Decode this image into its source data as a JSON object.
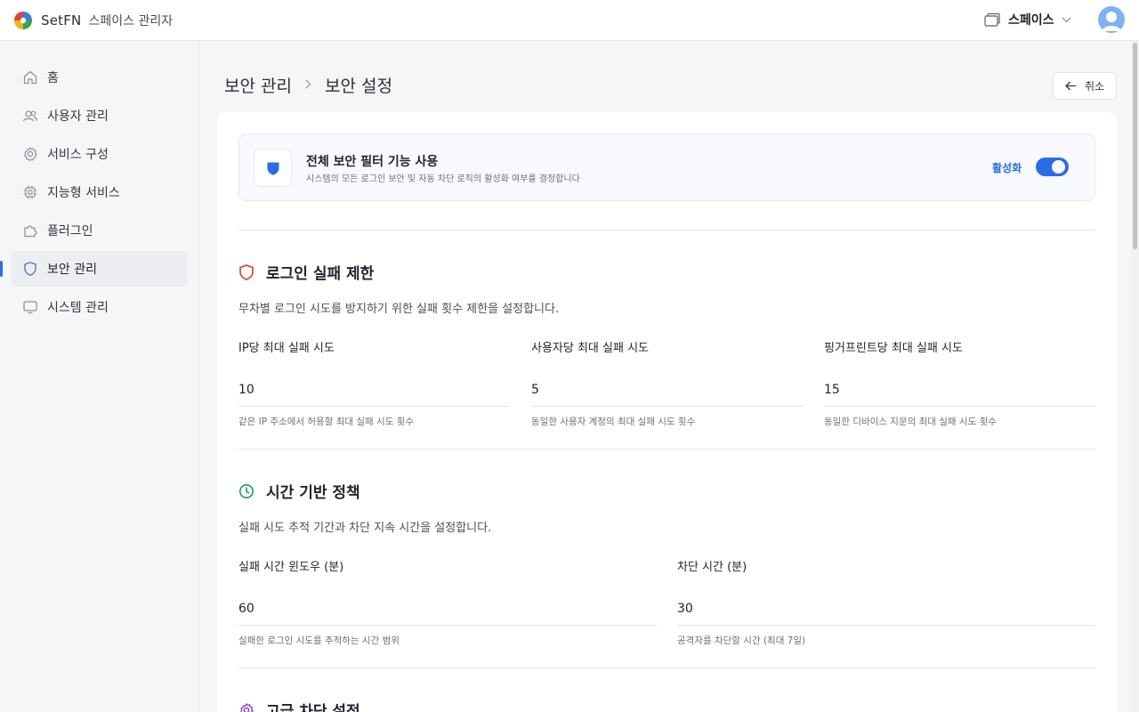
{
  "header": {
    "brand_name": "SetFN",
    "brand_sub": "스페이스 관리자",
    "space_label": "스페이스"
  },
  "sidebar": {
    "items": [
      {
        "label": "홈",
        "icon": "home-icon"
      },
      {
        "label": "사용자 관리",
        "icon": "users-icon"
      },
      {
        "label": "서비스 구성",
        "icon": "gear-icon"
      },
      {
        "label": "지능형 서비스",
        "icon": "chip-icon"
      },
      {
        "label": "플러그인",
        "icon": "puzzle-icon"
      },
      {
        "label": "보안 관리",
        "icon": "shield-icon",
        "active": true
      },
      {
        "label": "시스템 관리",
        "icon": "monitor-icon"
      }
    ]
  },
  "breadcrumb": {
    "parent": "보안 관리",
    "current": "보안 설정"
  },
  "cancel_label": "취소",
  "master": {
    "title": "전체 보안 필터 기능 사용",
    "desc": "시스템의 모든 로그인 보안 및 자동 차단 로직의 활성화 여부를 결정합니다",
    "state_label": "활성화",
    "enabled": true
  },
  "login_limit": {
    "title": "로그인 실패 제한",
    "desc": "무차별 로그인 시도를 방지하기 위한 실패 횟수 제한을 설정합니다.",
    "fields": [
      {
        "label": "IP당 최대 실패 시도",
        "value": "10",
        "help": "같은 IP 주소에서 허용할 최대 실패 시도 횟수"
      },
      {
        "label": "사용자당 최대 실패 시도",
        "value": "5",
        "help": "동일한 사용자 계정의 최대 실패 시도 횟수"
      },
      {
        "label": "핑거프린트당 최대 실패 시도",
        "value": "15",
        "help": "동일한 디바이스 지문의 최대 실패 시도 횟수"
      }
    ]
  },
  "time_policy": {
    "title": "시간 기반 정책",
    "desc": "실패 시도 추적 기간과 차단 지속 시간을 설정합니다.",
    "fields": [
      {
        "label": "실패 시간 윈도우 (분)",
        "value": "60",
        "help": "실패한 로그인 시도를 추적하는 시간 범위"
      },
      {
        "label": "차단 시간 (분)",
        "value": "30",
        "help": "공격자를 차단할 시간 (최대 7일)"
      }
    ]
  },
  "advanced": {
    "title": "고급 차단 설정"
  },
  "colors": {
    "accent": "#2b6be6",
    "login_icon": "#e0342b",
    "time_icon": "#1f9d55",
    "advanced_icon": "#8b3fd1"
  }
}
